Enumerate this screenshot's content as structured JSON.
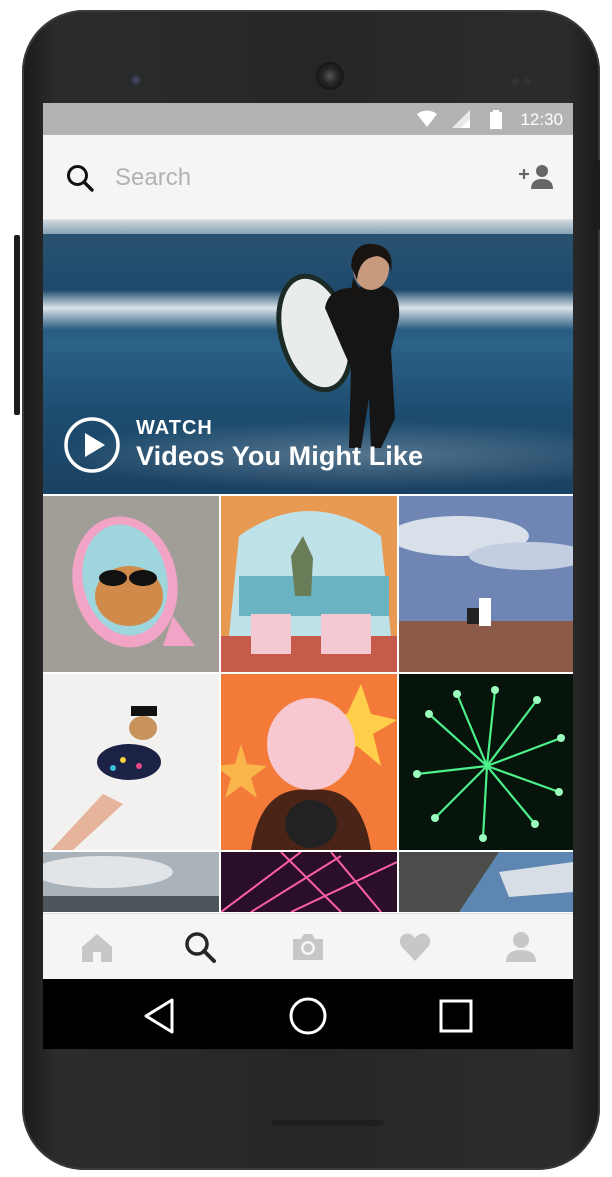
{
  "status_bar": {
    "time": "12:30",
    "icons": [
      "wifi-icon",
      "signal-icon",
      "battery-icon"
    ]
  },
  "search": {
    "placeholder": "Search",
    "value": "",
    "icon": "search-icon",
    "add_people_icon": "add-person-icon"
  },
  "hero": {
    "label": "WATCH",
    "title": "Videos You Might Like",
    "icon": "play-icon"
  },
  "grid": {
    "tiles": [
      "cat-sunglasses-mirror",
      "tent-beach-view",
      "canyon-proposal",
      "dog-held-up",
      "cotton-candy",
      "green-fireworks",
      "cloudy-sky",
      "pink-light-streaks",
      "snowy-forest"
    ]
  },
  "bottom_nav": {
    "items": [
      "home-icon",
      "search-icon",
      "camera-icon",
      "heart-icon",
      "profile-icon"
    ],
    "active": "search-icon"
  },
  "android_nav": {
    "items": [
      "back-icon",
      "home-circle-icon",
      "recents-icon"
    ]
  },
  "colors": {
    "status_bar_bg": "#b3b3b3",
    "toolbar_bg": "#f5f5f5",
    "placeholder": "#b2b2b2",
    "nav_inactive": "#c7c7c7",
    "nav_active": "#262626"
  }
}
